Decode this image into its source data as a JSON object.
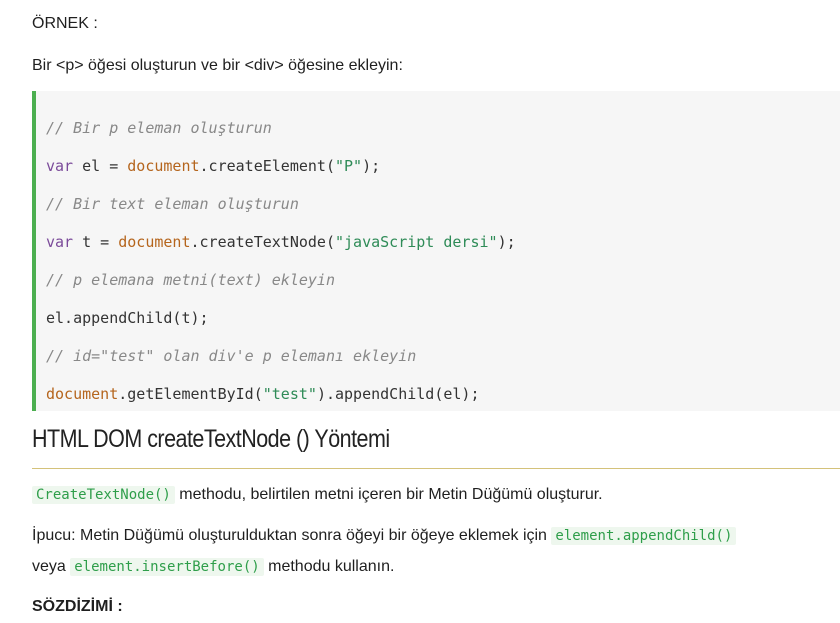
{
  "example": {
    "label": "ÖRNEK :",
    "intro": "Bir <p> öğesi oluşturun ve bir <div> öğesine ekleyin:"
  },
  "code": {
    "line1": "// Bir p eleman oluşturun",
    "line2_kw": "var",
    "line2_a": " el = ",
    "line2_obj": "document",
    "line2_b": ".createElement(",
    "line2_str": "\"P\"",
    "line2_c": ");",
    "line3": "// Bir text eleman oluşturun",
    "line4_kw": "var",
    "line4_a": " t = ",
    "line4_obj": "document",
    "line4_b": ".createTextNode(",
    "line4_str": "\"javaScript dersi\"",
    "line4_c": ");",
    "line5": "// p elemana metni(text) ekleyin",
    "line6": "el.appendChild(t);",
    "line7": "// id=\"test\" olan div'e p elemanı ekleyin",
    "line8_obj": "document",
    "line8_a": ".getElementById(",
    "line8_str": "\"test\"",
    "line8_b": ").appendChild(el);"
  },
  "section": {
    "title": "HTML DOM createTextNode () Yöntemi",
    "p1_code": "CreateTextNode()",
    "p1_text": " methodu, belirtilen metni içeren bir Metin Düğümü oluşturur.",
    "p2_text_a": "İpucu: Metin Düğümü oluşturulduktan sonra öğeyi bir öğeye eklemek için ",
    "p2_code_a": "element.appendChild()",
    "p3_text_a": "veya ",
    "p3_code": "element.insertBefore()",
    "p3_text_b": " methodu kullanın.",
    "syntax_label": "SÖZDİZİMİ :"
  }
}
